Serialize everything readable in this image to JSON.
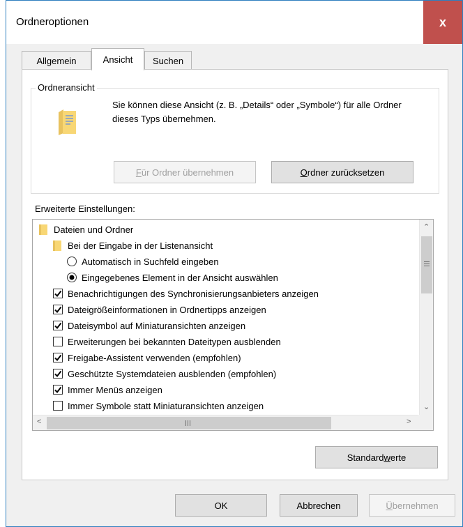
{
  "window": {
    "title": "Ordneroptionen",
    "close_label": "x"
  },
  "tabs": [
    {
      "label": "Allgemein"
    },
    {
      "label": "Ansicht"
    },
    {
      "label": "Suchen"
    }
  ],
  "folder_view": {
    "title": "Ordneransicht",
    "description": "Sie können diese Ansicht (z. B. „Details“ oder „Symbole“) für alle Ordner dieses Typs übernehmen.",
    "apply_button": {
      "mnemonic": "F",
      "rest": "ür Ordner übernehmen"
    },
    "reset_button": {
      "mnemonic": "O",
      "rest": "rdner zurücksetzen"
    }
  },
  "advanced": {
    "label": "Erweiterte Einstellungen:",
    "items": [
      {
        "type": "folder",
        "level": 0,
        "label": "Dateien und Ordner"
      },
      {
        "type": "folder",
        "level": 1,
        "label": "Bei der Eingabe in der Listenansicht"
      },
      {
        "type": "radio",
        "level": 2,
        "checked": false,
        "label": "Automatisch in Suchfeld eingeben"
      },
      {
        "type": "radio",
        "level": 2,
        "checked": true,
        "label": "Eingegebenes Element in der Ansicht auswählen"
      },
      {
        "type": "checkbox",
        "level": 1,
        "checked": true,
        "label": "Benachrichtigungen des Synchronisierungsanbieters anzeigen"
      },
      {
        "type": "checkbox",
        "level": 1,
        "checked": true,
        "label": "Dateigrößeinformationen in Ordnertipps anzeigen"
      },
      {
        "type": "checkbox",
        "level": 1,
        "checked": true,
        "label": "Dateisymbol auf Miniaturansichten anzeigen"
      },
      {
        "type": "checkbox",
        "level": 1,
        "checked": false,
        "label": "Erweiterungen bei bekannten Dateitypen ausblenden"
      },
      {
        "type": "checkbox",
        "level": 1,
        "checked": true,
        "label": "Freigabe-Assistent verwenden (empfohlen)"
      },
      {
        "type": "checkbox",
        "level": 1,
        "checked": true,
        "label": "Geschützte Systemdateien ausblenden (empfohlen)"
      },
      {
        "type": "checkbox",
        "level": 1,
        "checked": true,
        "label": "Immer Menüs anzeigen"
      },
      {
        "type": "checkbox",
        "level": 1,
        "checked": false,
        "label": "Immer Symbole statt Miniaturansichten anzeigen"
      }
    ],
    "defaults_button": {
      "before": "Standard",
      "mnemonic": "w",
      "after": "erte"
    }
  },
  "footer": {
    "ok_label": "OK",
    "cancel_label": "Abbrechen",
    "apply_button": {
      "mnemonic": "Ü",
      "rest": "bernehmen"
    }
  },
  "colors": {
    "close_bg": "#c0504d",
    "folder_yellow": "#f8d775",
    "focus_blue": "#0078d7"
  }
}
